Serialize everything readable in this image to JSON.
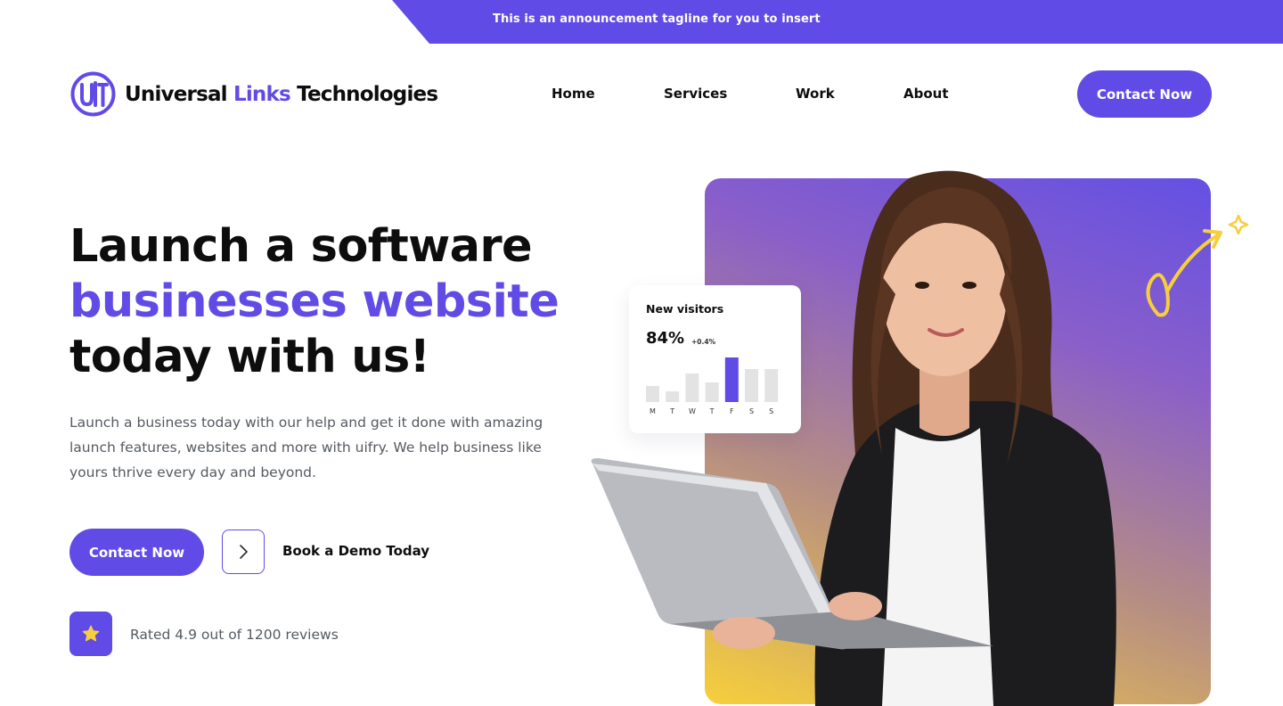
{
  "announcement": {
    "text": "This is an announcement tagline for you to insert"
  },
  "brand": {
    "name_part1": "Universal",
    "name_part2": "Links",
    "name_part3": "Technologies",
    "primary_color": "#614BE6",
    "accent_yellow": "#F7CF3C"
  },
  "nav": {
    "items": [
      {
        "label": "Home"
      },
      {
        "label": "Services"
      },
      {
        "label": "Work"
      },
      {
        "label": "About"
      }
    ],
    "cta_label": "Contact Now"
  },
  "hero": {
    "title_line1": "Launch a software",
    "title_line2": "businesses website",
    "title_line3": "today with us!",
    "description": "Launch a business today with our help and get it done with amazing launch features, websites and more with uifry. We help business like yours thrive every day and beyond.",
    "cta_label": "Contact Now",
    "demo_label": "Book a Demo Today",
    "rating_text": "Rated 4.9 out of 1200 reviews"
  },
  "visitors_card": {
    "title": "New visitors",
    "value": "84%",
    "change": "+0.4%"
  },
  "chart_data": {
    "type": "bar",
    "categories": [
      "M",
      "T",
      "W",
      "T",
      "F",
      "S",
      "S"
    ],
    "values": [
      18,
      12,
      32,
      22,
      50,
      37,
      37
    ],
    "highlight_index": 4,
    "highlight_color": "#614BE6",
    "bar_color": "#E3E3E3",
    "ylim": [
      0,
      50
    ]
  }
}
